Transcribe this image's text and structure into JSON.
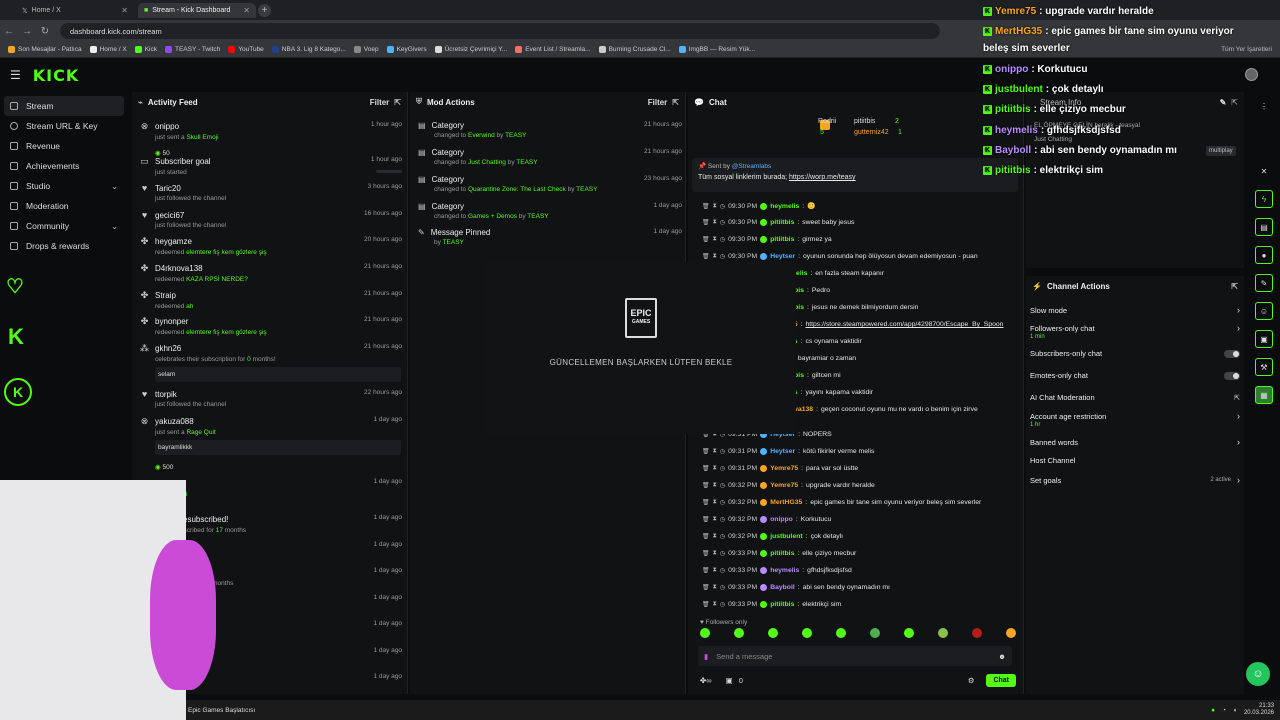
{
  "browser": {
    "tabs": [
      {
        "label": "Home / X"
      },
      {
        "label": "Stream - Kick Dashboard"
      }
    ],
    "url": "dashboard.kick.com/stream",
    "bookmarks": [
      "Son Mesajlar - Patlıca",
      "Home / X",
      "Kick",
      "TEASY - Twitch",
      "YouTube",
      "NBA 3. Lig 8 Katego...",
      "Voep",
      "KeyGivers",
      "Ücretsiz Çevrimiçi Y...",
      "Event List / Streamla...",
      "Burning Crusade Cl...",
      "ImgBB — Resim Yük..."
    ],
    "all_bookmarks": "Tüm Yer İşaretleri"
  },
  "sidebar": {
    "logo": "KICK",
    "items": [
      {
        "label": "Stream"
      },
      {
        "label": "Stream URL & Key"
      },
      {
        "label": "Revenue"
      },
      {
        "label": "Achievements"
      },
      {
        "label": "Studio"
      },
      {
        "label": "Moderation"
      },
      {
        "label": "Community"
      },
      {
        "label": "Drops & rewards"
      }
    ]
  },
  "activity": {
    "title": "Activity Feed",
    "filter": "Filter",
    "items": [
      {
        "name": "onippo",
        "sub": "just sent a ",
        "hl": "Skull Emoji",
        "time": "1 hour ago",
        "box": "50"
      },
      {
        "name": "Subscriber goal",
        "sub": "just started",
        "time": "1 hour ago"
      },
      {
        "name": "Taric20",
        "sub": "just followed the channel",
        "time": "3 hours ago"
      },
      {
        "name": "gecici67",
        "sub": "just followed the channel",
        "time": "16 hours ago"
      },
      {
        "name": "heygamze",
        "sub": "redeemed ",
        "hl": "elemtere fiş kem gözlere şiş",
        "time": "20 hours ago"
      },
      {
        "name": "D4rknova138",
        "sub": "redeemed ",
        "hl": "KAZA RPSİ NERDE?",
        "time": "21 hours ago"
      },
      {
        "name": "Straip",
        "sub": "redeemed ",
        "hl": "ah",
        "time": "21 hours ago"
      },
      {
        "name": "bynonper",
        "sub": "redeemed ",
        "hl": "elemtere fiş kem gözlere şiş",
        "time": "21 hours ago"
      },
      {
        "name": "gkhn26",
        "sub": "celebrates their subscription for ",
        "hl": "0",
        "sub2": " months!",
        "time": "21 hours ago",
        "box": "selam"
      },
      {
        "name": "ttorpik",
        "sub": "just followed the channel",
        "time": "22 hours ago"
      },
      {
        "name": "yakuza088",
        "sub": "just sent a ",
        "hl": "Rage Quit",
        "time": "1 day ago",
        "box": "bayramlikkk",
        "box2": "500"
      },
      {
        "name": "...po",
        "sub": "",
        "hl": "Skull Emoji",
        "time": "1 day ago"
      },
      {
        "name": "...nda Resubscribed!",
        "sub": "...een subscribed for ",
        "hl": "17",
        "sub2": " months",
        "time": "1 day ago"
      },
      {
        "name": "...goal",
        "sub": "",
        "time": "1 day ago"
      },
      {
        "name": "...subscribed!",
        "sub": "...subscribed for ",
        "hl": "10",
        "sub2": " months",
        "time": "1 day ago"
      },
      {
        "name": "...bed!",
        "sub": "...ibed for ",
        "hl": "1",
        "sub2": " month",
        "time": "1 day ago"
      },
      {
        "name": "",
        "sub": "...nnel",
        "time": "1 day ago"
      },
      {
        "name": "",
        "sub": "",
        "time": "1 day ago"
      },
      {
        "name": "",
        "sub": "...the channel",
        "time": "1 day ago"
      }
    ]
  },
  "mod": {
    "title": "Mod Actions",
    "filter": "Filter",
    "items": [
      {
        "title": "Category",
        "pre": "changed to ",
        "hl": "Everwind",
        "by": "TEASY",
        "time": "21 hours ago"
      },
      {
        "title": "Category",
        "pre": "changed to ",
        "hl": "Just Chatting",
        "by": "TEASY",
        "time": "21 hours ago"
      },
      {
        "title": "Category",
        "pre": "changed to ",
        "hl": "Quarantine Zone: The Last Check",
        "by": "TEASY",
        "time": "23 hours ago"
      },
      {
        "title": "Category",
        "pre": "changed to ",
        "hl": "Games + Demos",
        "by": "TEASY",
        "time": "1 day ago"
      },
      {
        "title": "Message Pinned",
        "pre": "by ",
        "hl": "TEASY",
        "by": "",
        "time": "1 day ago"
      }
    ]
  },
  "epic": {
    "logo1": "EPIC",
    "logo2": "GAMES",
    "text": "GÜNCELLEMEN BAŞLARKEN LÜTFEN BEKLE"
  },
  "chat": {
    "title": "Chat",
    "podium": {
      "first": "Rodrii",
      "second": "pitiitbis",
      "second_n": "2",
      "third": "gutterniz42",
      "third_n": "1",
      "first_n": "5"
    },
    "pinned": {
      "sent_by": "Sent by",
      "bot": "@Streamlabs",
      "text": "Tüm sosyal linklerim burada; ",
      "link": "https://worp.me/teasy"
    },
    "messages": [
      {
        "t": "09:30 PM",
        "u": "heymelis",
        "c": "#53fc18",
        "m": "🙂"
      },
      {
        "t": "09:30 PM",
        "u": "pitiitbis",
        "c": "#53fc18",
        "m": "sweet baby jesus"
      },
      {
        "t": "09:30 PM",
        "u": "pitiitbis",
        "c": "#53fc18",
        "m": "girmez ya"
      },
      {
        "t": "09:30 PM",
        "u": "Heytser",
        "c": "#4fb3ff",
        "m": "oyunun sonunda hep ölüyosun devam edemiyosun - puan"
      },
      {
        "t": "",
        "u": "melis",
        "c": "#53fc18",
        "m": "en fazla steam kapanır"
      },
      {
        "t": "",
        "u": "itbis",
        "c": "#53fc18",
        "m": "Pedro"
      },
      {
        "t": "",
        "u": "itbis",
        "c": "#53fc18",
        "m": "jesus ne demek bilmiyordum dersin"
      },
      {
        "t": "",
        "u": "75",
        "c": "#f5a623",
        "m": "https://store.steampowered.com/app/4298700/Escape_By_Spoon"
      },
      {
        "t": "",
        "u": "lis",
        "c": "#53fc18",
        "m": "cs oynama vaktidir"
      },
      {
        "t": "",
        "u": "",
        "c": "#53fc18",
        "m": "bayramiar o zaman"
      },
      {
        "t": "",
        "u": "itbis",
        "c": "#53fc18",
        "m": "giltcen mi"
      },
      {
        "t": "",
        "u": "lis",
        "c": "#53fc18",
        "m": "yayını kapama vaktidir"
      },
      {
        "t": "",
        "u": "ova138",
        "c": "#f5a623",
        "m": "geçen coconut oyunu mu ne vardı o benim için zirve"
      },
      {
        "t": "09:31 PM",
        "u": "Heytser",
        "c": "#4fb3ff",
        "m": "NOPERS"
      },
      {
        "t": "09:31 PM",
        "u": "Heytser",
        "c": "#4fb3ff",
        "m": "kötü fikirler verme melis"
      },
      {
        "t": "09:31 PM",
        "u": "Yemre75",
        "c": "#f5a623",
        "m": "para var sol üstte"
      },
      {
        "t": "09:32 PM",
        "u": "Yemre75",
        "c": "#f5a623",
        "m": "upgrade vardır heralde"
      },
      {
        "t": "09:32 PM",
        "u": "MertHG35",
        "c": "#f5a623",
        "m": "epic games bir tane sim oyunu veriyor beleş sim severler"
      },
      {
        "t": "09:32 PM",
        "u": "onippo",
        "c": "#b98cff",
        "m": "Korkutucu"
      },
      {
        "t": "09:32 PM",
        "u": "justbulent",
        "c": "#53fc18",
        "m": "çok detaylı"
      },
      {
        "t": "09:33 PM",
        "u": "pitiitbis",
        "c": "#53fc18",
        "m": "elle çiziyo mecbur"
      },
      {
        "t": "09:33 PM",
        "u": "heymelis",
        "c": "#b98cff",
        "m": "gfhdsjfksdjsfsd"
      },
      {
        "t": "09:33 PM",
        "u": "Bayboll",
        "c": "#b98cff",
        "m": "abi sen bendy oynamadın mı"
      },
      {
        "t": "09:33 PM",
        "u": "pitiitbis",
        "c": "#53fc18",
        "m": "elektrikçi sim"
      }
    ],
    "followers_only": "Followers only",
    "placeholder": "Send a message",
    "count": "0",
    "send": "Chat"
  },
  "stream_info": {
    "title": "Stream Info",
    "line1": "EL ÖPMEYE GELİN heralik - teasyal",
    "cat": "Just Chatting",
    "tag": "multiplay"
  },
  "channel_actions": {
    "title": "Channel Actions",
    "items": [
      {
        "label": "Slow mode",
        "kind": "arrow"
      },
      {
        "label": "Followers-only chat",
        "kind": "arrow",
        "sub": "1 min"
      },
      {
        "label": "Subscribers-only chat",
        "kind": "toggle"
      },
      {
        "label": "Emotes-only chat",
        "kind": "toggle"
      },
      {
        "label": "AI Chat Moderation",
        "kind": "link"
      },
      {
        "label": "Account age restriction",
        "kind": "arrow",
        "sub": "1 hr"
      },
      {
        "label": "Banned words",
        "kind": "arrow"
      },
      {
        "label": "Host Channel",
        "kind": "none"
      },
      {
        "label": "Set goals",
        "kind": "arrow",
        "extra": "2 active"
      }
    ]
  },
  "overlay": [
    {
      "u": "Yemre75",
      "c": "#f5a623",
      "m": ": upgrade vardır heralde"
    },
    {
      "u": "MertHG35",
      "c": "#f5a623",
      "m": ": epic games bir tane sim oyunu veriyor"
    },
    {
      "u": "",
      "c": "#fff",
      "m": "beleş sim severler"
    },
    {
      "u": "onippo",
      "c": "#b98cff",
      "m": ": Korkutucu"
    },
    {
      "u": "justbulent",
      "c": "#53fc18",
      "m": ": çok detaylı"
    },
    {
      "u": "pitiitbis",
      "c": "#53fc18",
      "m": ": elle çiziyo mecbur"
    },
    {
      "u": "heymelis",
      "c": "#b98cff",
      "m": ": gfhdsjfksdjsfsd"
    },
    {
      "u": "Bayboll",
      "c": "#b98cff",
      "m": ": abi sen bendy oynamadın mı"
    },
    {
      "u": "pitiitbis",
      "c": "#53fc18",
      "m": ": elektrikçi sim"
    }
  ],
  "taskbar": {
    "app": "Epic Games Başlatıcısı",
    "time": "21:33",
    "date": "20.03.2026"
  },
  "colors": {
    "accent": "#53fc18",
    "bg": "#0b0c0e",
    "panel": "#111214"
  }
}
